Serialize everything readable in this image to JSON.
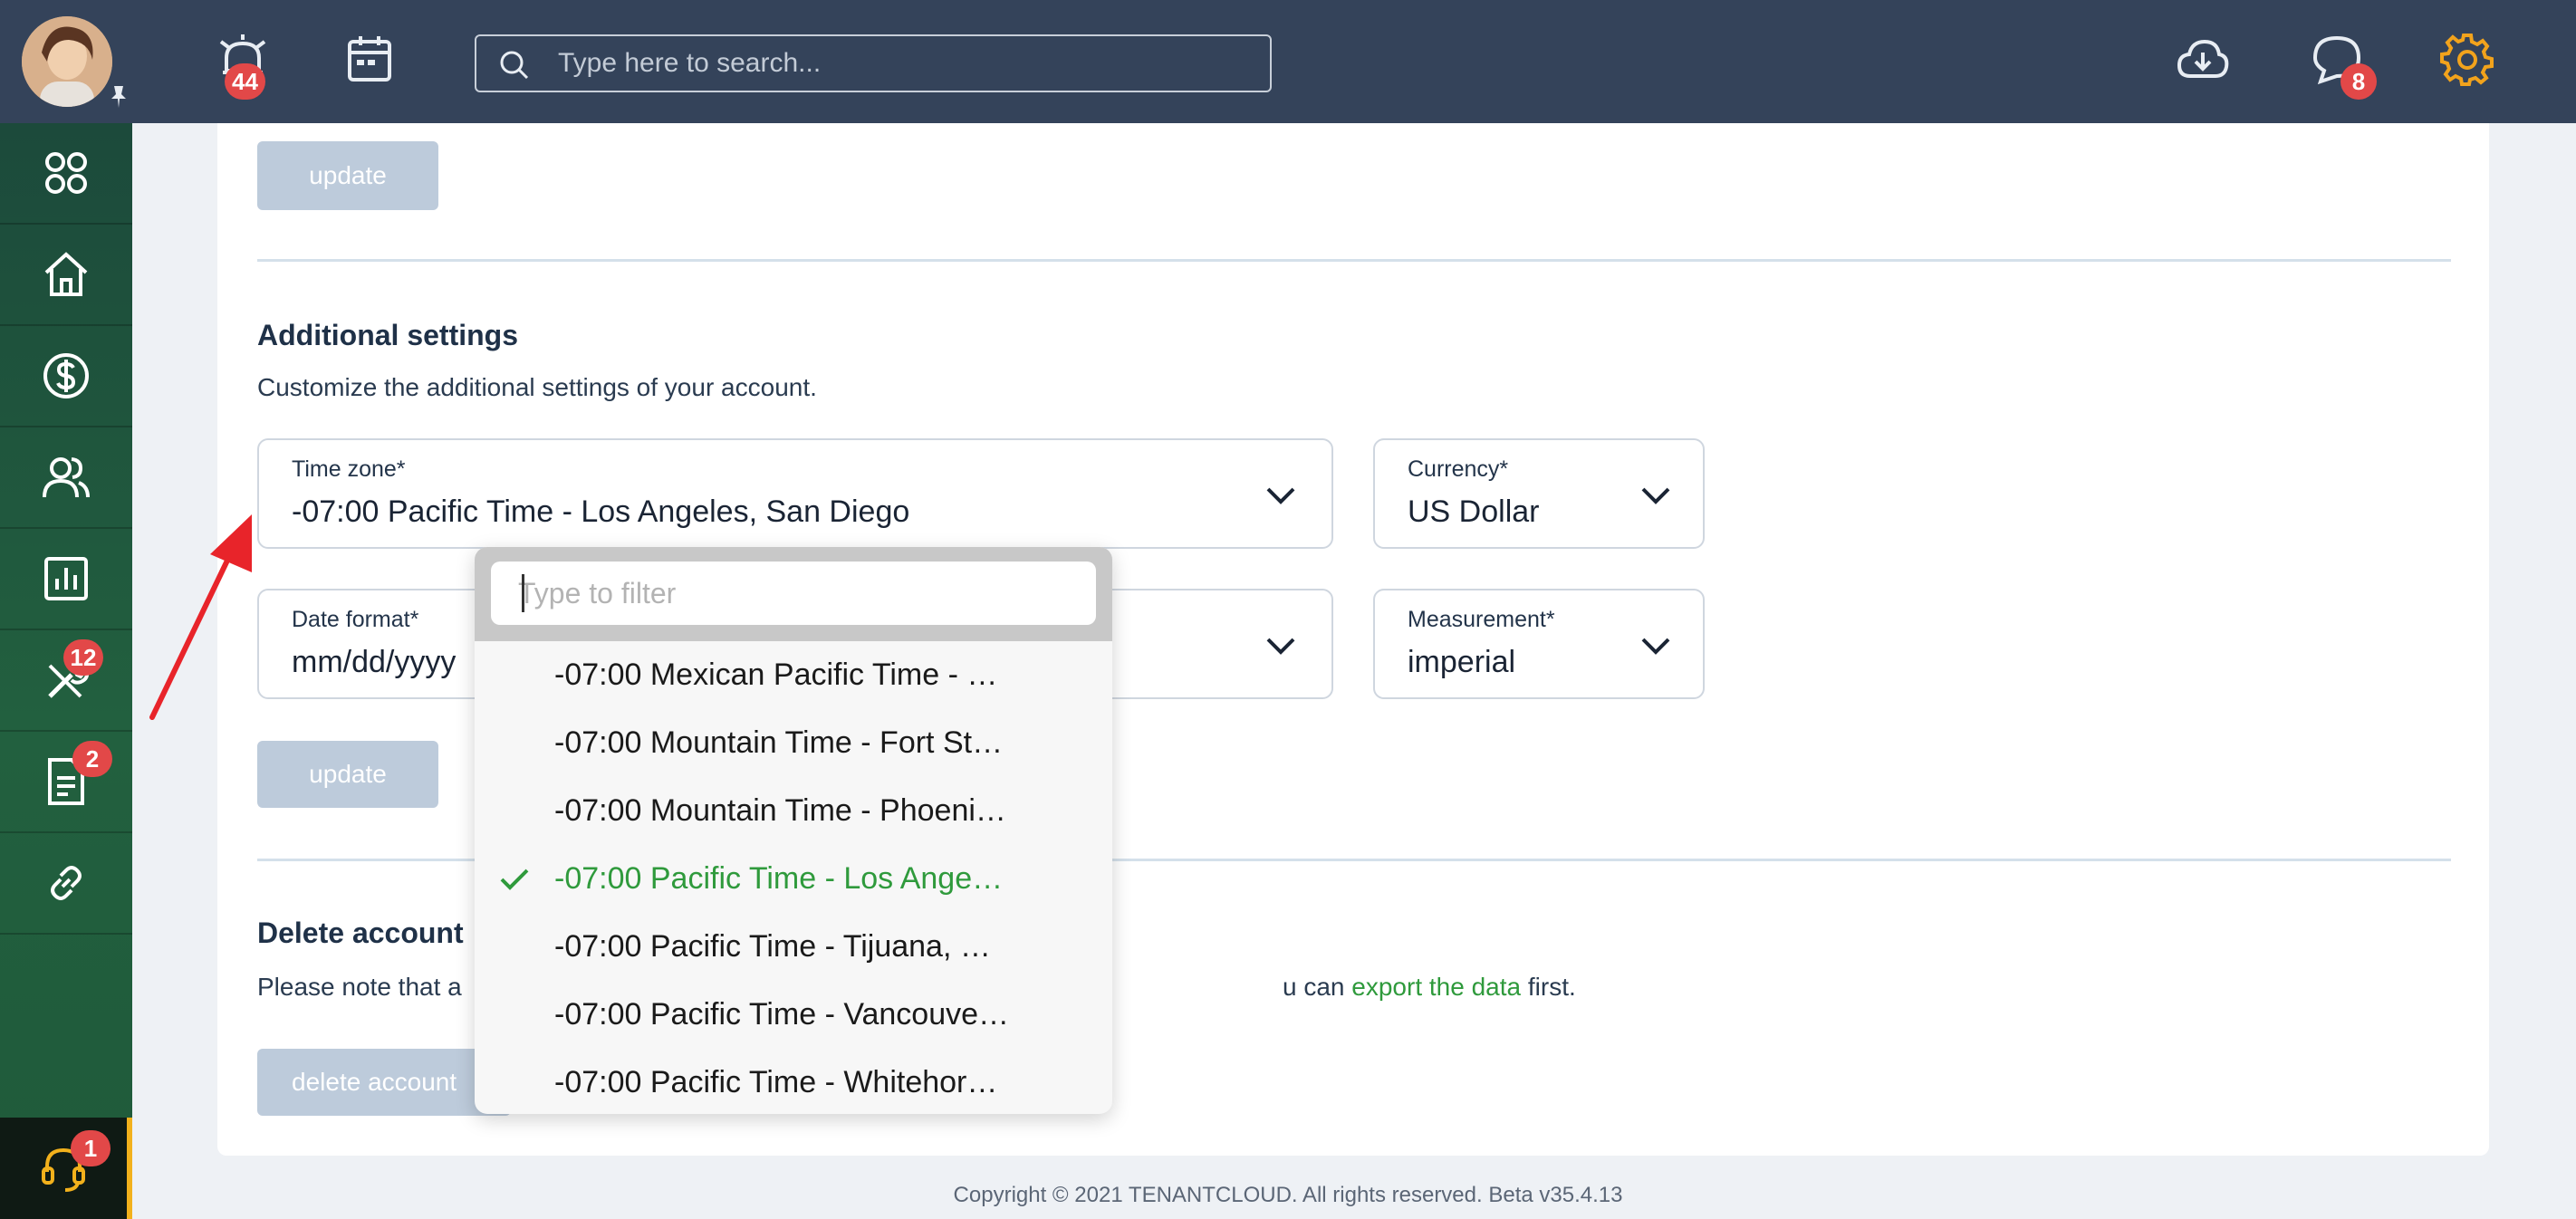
{
  "header": {
    "alarm_badge": "44",
    "messages_badge": "8",
    "search_placeholder": "Type here to search..."
  },
  "sidebar": {
    "items": [
      {
        "name": "dashboard",
        "icon": "apps-icon",
        "badge": ""
      },
      {
        "name": "properties",
        "icon": "home-icon",
        "badge": ""
      },
      {
        "name": "accounting",
        "icon": "dollar-icon",
        "badge": ""
      },
      {
        "name": "contacts",
        "icon": "people-icon",
        "badge": ""
      },
      {
        "name": "reports",
        "icon": "chart-icon",
        "badge": ""
      },
      {
        "name": "maintenance",
        "icon": "tools-icon",
        "badge": "12"
      },
      {
        "name": "documents",
        "icon": "document-icon",
        "badge": "2"
      },
      {
        "name": "links",
        "icon": "link-icon",
        "badge": ""
      }
    ],
    "support_badge": "1"
  },
  "content": {
    "top_update_label": "update",
    "additional": {
      "title": "Additional settings",
      "description": "Customize the additional settings of your account.",
      "timezone_label": "Time zone*",
      "timezone_value": "-07:00 Pacific Time - Los Angeles, San Diego",
      "currency_label": "Currency*",
      "currency_value": "US Dollar",
      "date_format_label": "Date format*",
      "date_format_value": "mm/dd/yyyy",
      "measurement_label": "Measurement*",
      "measurement_value": "imperial",
      "update_label": "update"
    },
    "delete": {
      "title": "Delete account",
      "text_start": "Please note that a",
      "text_mid": "u can ",
      "link": "export the data",
      "text_end": " first.",
      "button_label": "delete account"
    }
  },
  "dropdown": {
    "filter_placeholder": "Type to filter",
    "options": [
      {
        "label": "-07:00 Mexican Pacific Time - …"
      },
      {
        "label": "-07:00 Mountain Time - Fort St…"
      },
      {
        "label": "-07:00 Mountain Time - Phoeni…"
      },
      {
        "label": "-07:00 Pacific Time - Los Ange…"
      },
      {
        "label": "-07:00 Pacific Time - Tijuana, …"
      },
      {
        "label": "-07:00 Pacific Time - Vancouve…"
      },
      {
        "label": "-07:00 Pacific Time - Whitehor…"
      }
    ],
    "selected_index": 3
  },
  "footer": {
    "copyright": "Copyright © 2021 TENANTCLOUD. All rights reserved. Beta v35.4.13"
  },
  "colors": {
    "topbar": "#34435a",
    "accent_green": "#2f9a3c",
    "badge_red": "#e24848",
    "gear_orange": "#f2a31c"
  }
}
